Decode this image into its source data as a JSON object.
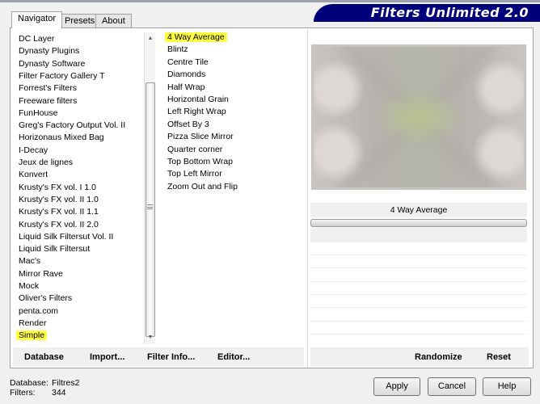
{
  "window": {
    "title": "Filters Unlimited 2.0"
  },
  "tabs": [
    {
      "label": "Navigator",
      "active": true
    },
    {
      "label": "Presets",
      "active": false
    },
    {
      "label": "About",
      "active": false
    }
  ],
  "categories": {
    "items": [
      "DC Layer",
      "Dynasty Plugins",
      "Dynasty Software",
      "Filter Factory Gallery T",
      "Forrest's Filters",
      "Freeware filters",
      "FunHouse",
      "Greg's Factory Output Vol. II",
      "Horizonaus Mixed Bag",
      "I-Decay",
      "Jeux de lignes",
      "Konvert",
      "Krusty's FX vol. I 1.0",
      "Krusty's FX vol. II 1.0",
      "Krusty's FX vol. II 1.1",
      "Krusty's FX vol. II 2.0",
      "Liquid Silk Filtersut Vol. II",
      "Liquid Silk Filtersut",
      "Mac's",
      "Mirror Rave",
      "Mock",
      "Oliver's Filters",
      "penta.com",
      "Render",
      "Simple"
    ],
    "selected": "Simple"
  },
  "filters": {
    "items": [
      "4 Way Average",
      "Blintz",
      "Centre Tile",
      "Diamonds",
      "Half Wrap",
      "Horizontal Grain",
      "Left Right Wrap",
      "Offset By 3",
      "Pizza Slice Mirror",
      "Quarter corner",
      "Top Bottom Wrap",
      "Top Left Mirror",
      "Zoom Out and Flip"
    ],
    "selected": "4 Way Average"
  },
  "preview": {
    "filter_name": "4 Way Average"
  },
  "toolbar": {
    "database": "Database",
    "import": "Import...",
    "filter_info": "Filter Info...",
    "editor": "Editor...",
    "randomize": "Randomize",
    "reset": "Reset"
  },
  "status": {
    "database_label": "Database:",
    "database_value": "Filtres2",
    "filters_label": "Filters:",
    "filters_value": "344"
  },
  "buttons": {
    "apply": "Apply",
    "cancel": "Cancel",
    "help": "Help"
  },
  "colors": {
    "banner": "#00007a",
    "highlight": "#ffff40"
  }
}
